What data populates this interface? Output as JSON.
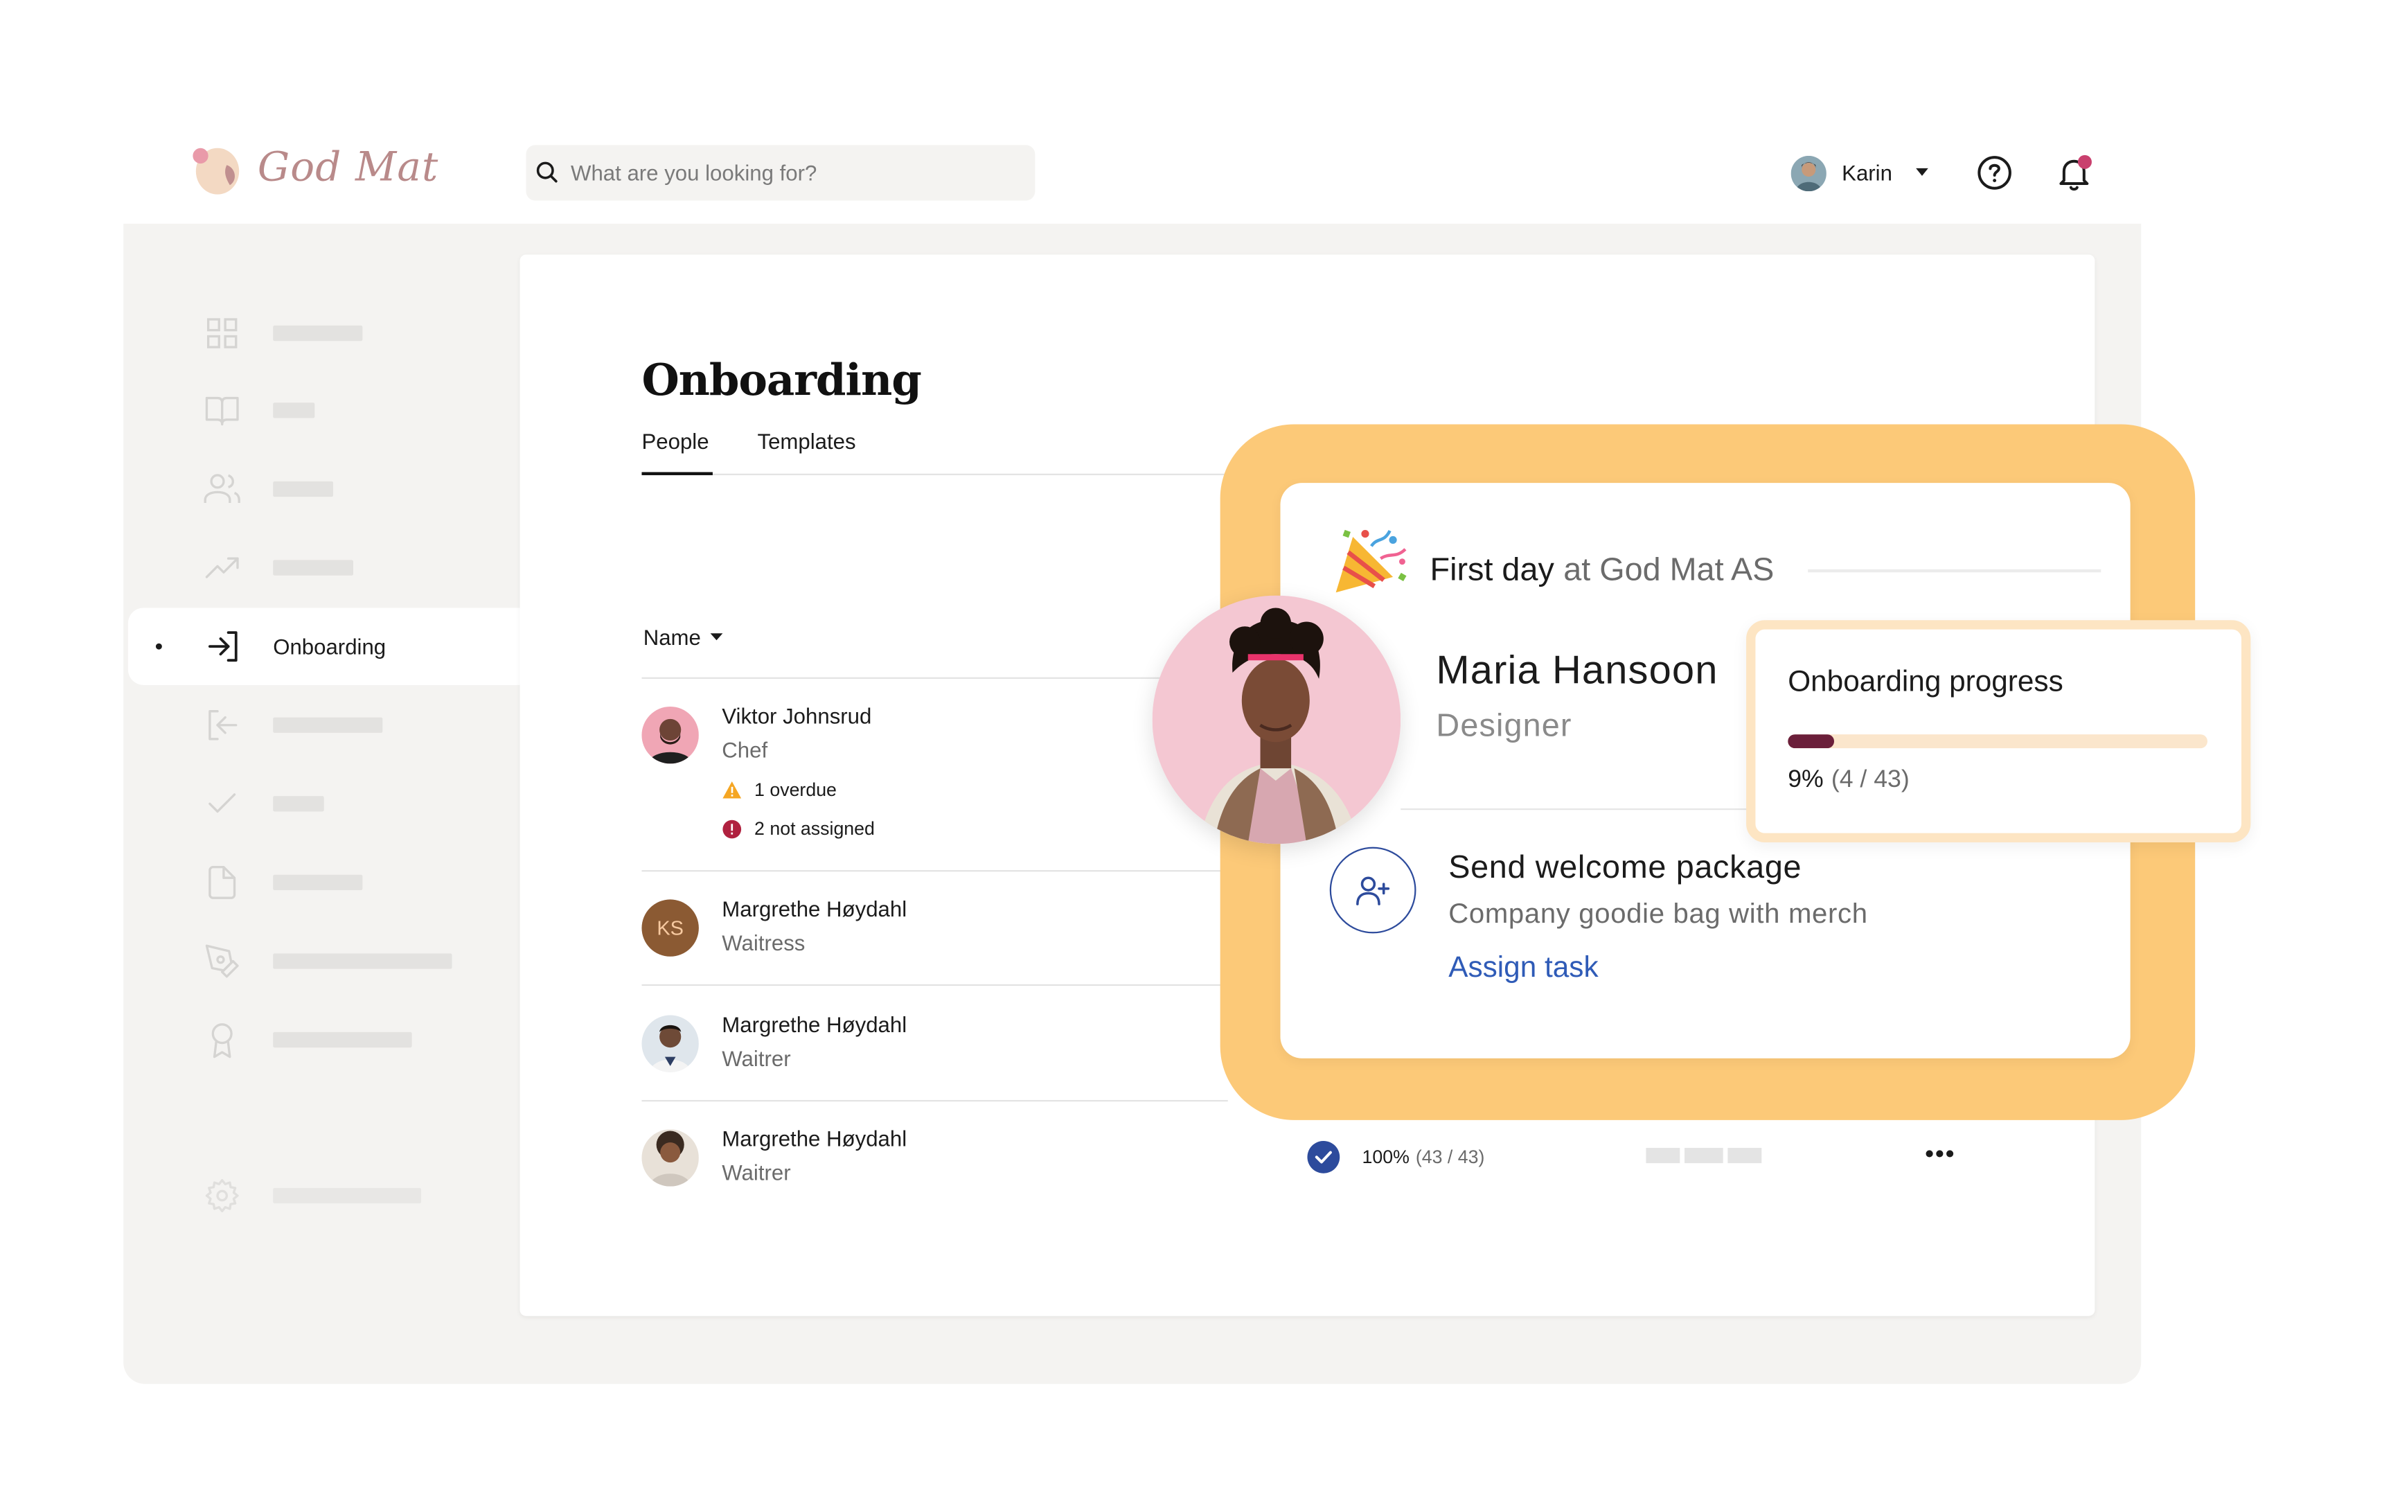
{
  "app": {
    "brand": "God Mat",
    "brand_color": "#b98a8a"
  },
  "search": {
    "placeholder": "What are you looking for?"
  },
  "user": {
    "name": "Karin",
    "has_notifications": true,
    "notification_color": "#c9406e"
  },
  "sidebar": {
    "items": [
      {
        "icon": "grid-icon",
        "active": false
      },
      {
        "icon": "book-icon",
        "active": false
      },
      {
        "icon": "users-icon",
        "active": false
      },
      {
        "icon": "trending-up-icon",
        "active": false
      },
      {
        "icon": "sign-in-icon",
        "label": "Onboarding",
        "active": true
      },
      {
        "icon": "sign-out-icon",
        "active": false
      },
      {
        "icon": "check-icon",
        "active": false
      },
      {
        "icon": "file-icon",
        "active": false
      },
      {
        "icon": "pen-tool-icon",
        "active": false
      },
      {
        "icon": "award-icon",
        "active": false
      },
      {
        "icon": "settings-icon",
        "active": false
      }
    ]
  },
  "page": {
    "title": "Onboarding",
    "tabs": [
      {
        "label": "People",
        "active": true
      },
      {
        "label": "Templates",
        "active": false
      }
    ],
    "name_header": "Name"
  },
  "people": [
    {
      "name": "Viktor Johnsrud",
      "role": "Chef",
      "badges": [
        {
          "type": "warning",
          "text": "1 overdue"
        },
        {
          "type": "error",
          "text": "2 not assigned"
        }
      ]
    },
    {
      "name": "Margrethe Høydahl",
      "role": "Waitress",
      "initials": "KS"
    },
    {
      "name": "Margrethe Høydahl",
      "role": "Waitrer"
    },
    {
      "name": "Margrethe Høydahl",
      "role": "Waitrer",
      "progress_pct": "100%",
      "progress_count": "(43 / 43)",
      "complete": true
    }
  ],
  "welcome": {
    "first_day_strong": "First day",
    "first_day_rest": "at God Mat AS",
    "employee_name": "Maria Hansoon",
    "employee_role": "Designer"
  },
  "progress": {
    "title": "Onboarding progress",
    "pct_label": "9%",
    "count_label": "(4 / 43)",
    "fraction": 0.11,
    "fill_color": "#6b1f3a",
    "track_color": "#fbe6cc"
  },
  "task": {
    "title": "Send welcome package",
    "description": "Company goodie bag with merch",
    "action": "Assign task",
    "action_color": "#2f5bb7"
  },
  "colors": {
    "highlight": "#fcc978",
    "frame": "#f4f3f1",
    "accent_blue": "#2d4b9c"
  }
}
